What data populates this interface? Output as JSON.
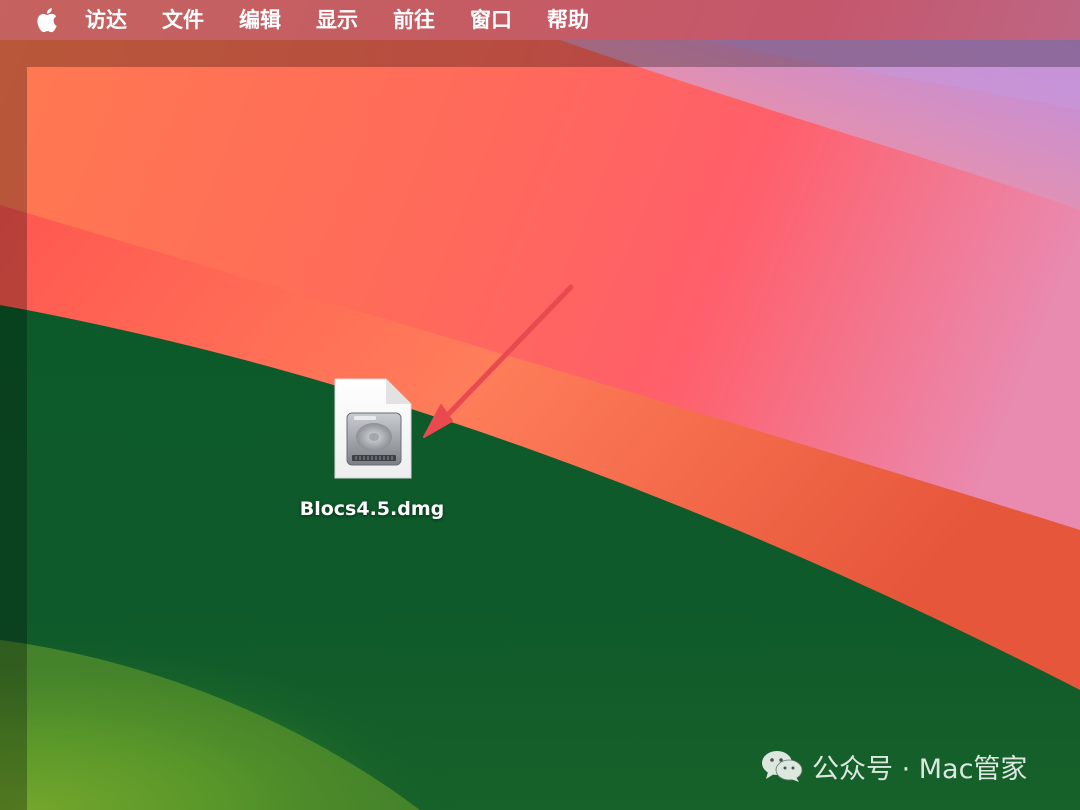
{
  "menubar": {
    "apple_icon": "apple-logo-icon",
    "items": [
      {
        "label": "访达"
      },
      {
        "label": "文件"
      },
      {
        "label": "编辑"
      },
      {
        "label": "显示"
      },
      {
        "label": "前往"
      },
      {
        "label": "窗口"
      },
      {
        "label": "帮助"
      }
    ]
  },
  "desktop": {
    "file": {
      "name": "Blocs4.5.dmg",
      "icon": "disk-image-file-icon"
    },
    "annotation_arrow_color": "#e94a4f"
  },
  "watermark": {
    "icon": "wechat-icon",
    "text": "公众号 · Mac管家"
  },
  "colors": {
    "wallpaper_green": "#0f5a2a",
    "wallpaper_orange": "#ff7a52",
    "wallpaper_red": "#ff5a5f",
    "wallpaper_pink": "#d98bb0",
    "wallpaper_purple": "#b68ae0",
    "wallpaper_lime": "#6fa52a"
  }
}
